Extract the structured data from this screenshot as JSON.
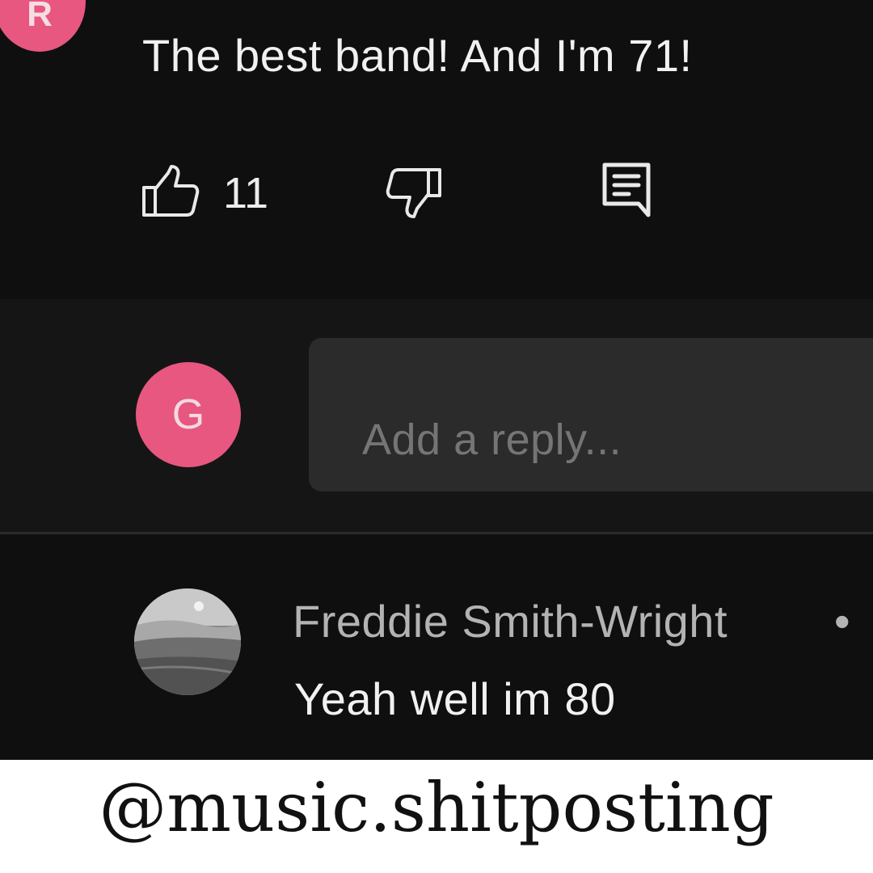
{
  "comment": {
    "avatar_letter": "R",
    "avatar_color": "#e75780",
    "text": "The best band! And I'm 71!",
    "likes": "11",
    "icons": [
      "thumbs-up-icon",
      "thumbs-down-icon",
      "reply-comment-icon"
    ]
  },
  "reply_box": {
    "avatar_letter": "G",
    "placeholder": "Add a reply..."
  },
  "reply": {
    "author": "Freddie Smith-Wright",
    "separator": "•",
    "text": "Yeah well im 80"
  },
  "watermark": "@music.shitposting",
  "colors": {
    "background": "#0f0f0f",
    "reply_section": "#151515",
    "input_bg": "#2b2b2b",
    "accent": "#e75780"
  }
}
